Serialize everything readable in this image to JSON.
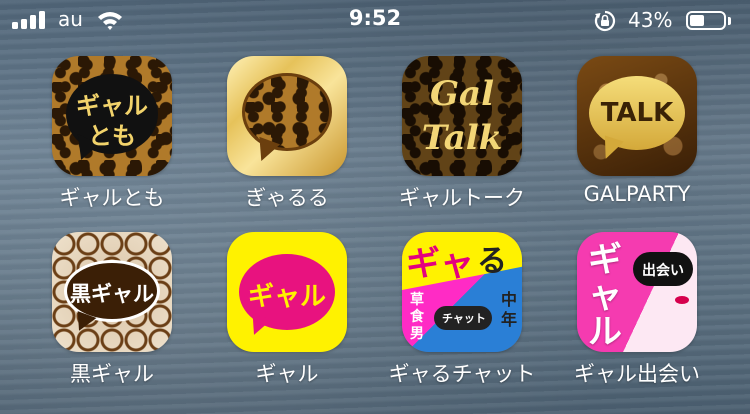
{
  "status_bar": {
    "carrier": "au",
    "time": "9:52",
    "battery_percent": "43%",
    "battery_level": 0.43,
    "icons": [
      "cellular-signal-icon",
      "wifi-icon",
      "rotation-lock-icon",
      "battery-icon"
    ]
  },
  "apps": [
    {
      "label": "ギャルとも",
      "icon_text": [
        "ギャル",
        "とも"
      ]
    },
    {
      "label": "ぎゃるる",
      "icon_text": []
    },
    {
      "label": "ギャルトーク",
      "icon_text": [
        "Gal",
        "Talk"
      ]
    },
    {
      "label": "GALPARTY",
      "icon_text": [
        "TALK"
      ]
    },
    {
      "label": "黒ギャル",
      "icon_text": [
        "黒ギャル"
      ]
    },
    {
      "label": "ギャル",
      "icon_text": [
        "ギャル"
      ]
    },
    {
      "label": "ギャるチャット",
      "icon_text": [
        "ギャ",
        "る",
        "チャット",
        "草食男",
        "中年"
      ]
    },
    {
      "label": "ギャル出会い",
      "icon_text": [
        "ギャル",
        "出会い"
      ]
    }
  ]
}
